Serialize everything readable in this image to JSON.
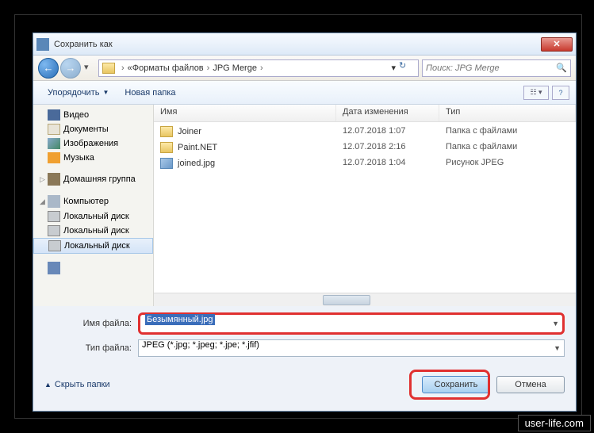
{
  "window": {
    "title": "Сохранить как"
  },
  "nav": {
    "path_prefix": "«",
    "path1": "Форматы файлов",
    "path2": "JPG Merge",
    "search_placeholder": "Поиск: JPG Merge"
  },
  "toolbar": {
    "organize": "Упорядочить",
    "new_folder": "Новая папка"
  },
  "sidebar": {
    "video": "Видео",
    "documents": "Документы",
    "images": "Изображения",
    "music": "Музыка",
    "homegroup": "Домашняя группа",
    "computer": "Компьютер",
    "localdisk1": "Локальный диск",
    "localdisk2": "Локальный диск",
    "localdisk3": "Локальный диск"
  },
  "columns": {
    "name": "Имя",
    "date": "Дата изменения",
    "type": "Тип"
  },
  "files": [
    {
      "name": "Joiner",
      "date": "12.07.2018 1:07",
      "type": "Папка с файлами",
      "kind": "folder"
    },
    {
      "name": "Paint.NET",
      "date": "12.07.2018 2:16",
      "type": "Папка с файлами",
      "kind": "folder"
    },
    {
      "name": "joined.jpg",
      "date": "12.07.2018 1:04",
      "type": "Рисунок JPEG",
      "kind": "jpg"
    }
  ],
  "fields": {
    "filename_label": "Имя файла:",
    "filename_value": "Безымянный.jpg",
    "filetype_label": "Тип файла:",
    "filetype_value": "JPEG (*.jpg; *.jpeg; *.jpe; *.jfif)"
  },
  "footer": {
    "hide_folders": "Скрыть папки",
    "save": "Сохранить",
    "cancel": "Отмена"
  },
  "watermark": "user-life.com"
}
